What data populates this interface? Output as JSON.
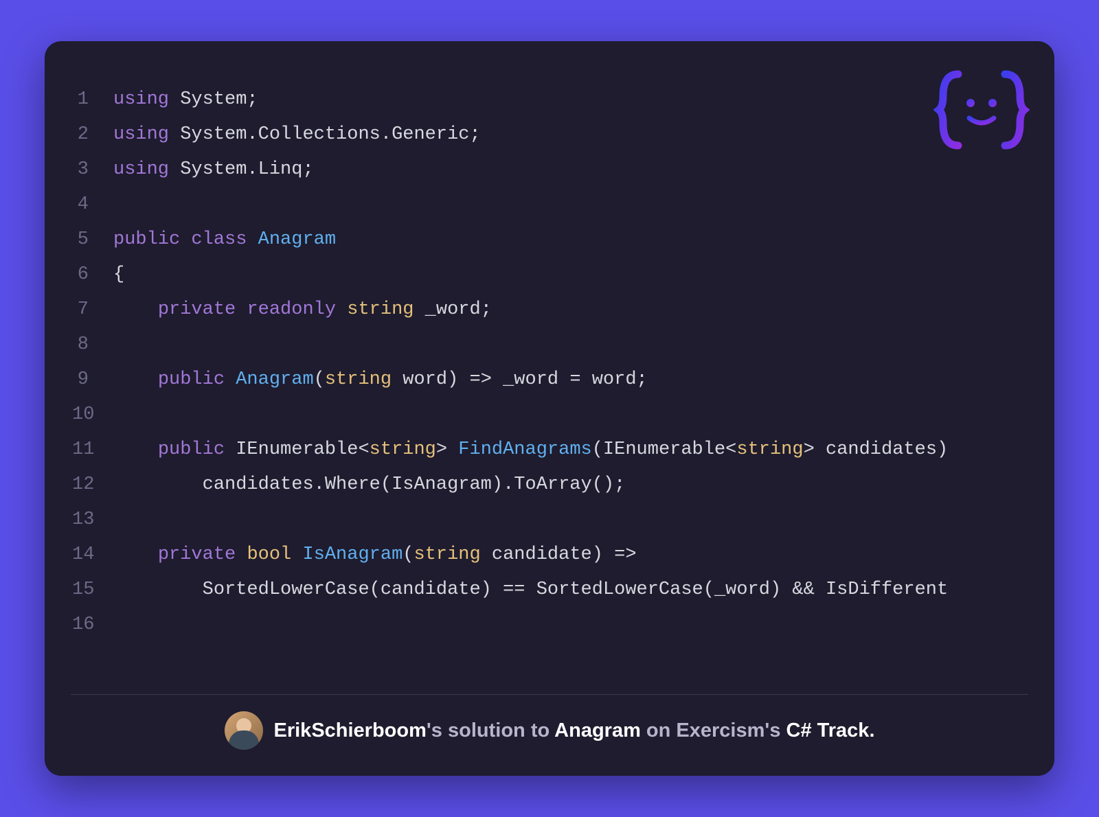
{
  "code": {
    "lines": [
      [
        {
          "t": "keyword",
          "v": "using"
        },
        {
          "t": "plain",
          "v": " System;"
        }
      ],
      [
        {
          "t": "keyword",
          "v": "using"
        },
        {
          "t": "plain",
          "v": " System.Collections.Generic;"
        }
      ],
      [
        {
          "t": "keyword",
          "v": "using"
        },
        {
          "t": "plain",
          "v": " System.Linq;"
        }
      ],
      [],
      [
        {
          "t": "keyword",
          "v": "public"
        },
        {
          "t": "plain",
          "v": " "
        },
        {
          "t": "keyword",
          "v": "class"
        },
        {
          "t": "plain",
          "v": " "
        },
        {
          "t": "type-blue",
          "v": "Anagram"
        }
      ],
      [
        {
          "t": "plain",
          "v": "{"
        }
      ],
      [
        {
          "t": "plain",
          "v": "    "
        },
        {
          "t": "keyword",
          "v": "private"
        },
        {
          "t": "plain",
          "v": " "
        },
        {
          "t": "keyword",
          "v": "readonly"
        },
        {
          "t": "plain",
          "v": " "
        },
        {
          "t": "type-yellow",
          "v": "string"
        },
        {
          "t": "plain",
          "v": " _word;"
        }
      ],
      [],
      [
        {
          "t": "plain",
          "v": "    "
        },
        {
          "t": "keyword",
          "v": "public"
        },
        {
          "t": "plain",
          "v": " "
        },
        {
          "t": "type-blue",
          "v": "Anagram"
        },
        {
          "t": "plain",
          "v": "("
        },
        {
          "t": "type-yellow",
          "v": "string"
        },
        {
          "t": "plain",
          "v": " word) => _word = word;"
        }
      ],
      [],
      [
        {
          "t": "plain",
          "v": "    "
        },
        {
          "t": "keyword",
          "v": "public"
        },
        {
          "t": "plain",
          "v": " IEnumerable<"
        },
        {
          "t": "type-yellow",
          "v": "string"
        },
        {
          "t": "plain",
          "v": "> "
        },
        {
          "t": "ident",
          "v": "FindAnagrams"
        },
        {
          "t": "plain",
          "v": "(IEnumerable<"
        },
        {
          "t": "type-yellow",
          "v": "string"
        },
        {
          "t": "plain",
          "v": "> candidates)"
        }
      ],
      [
        {
          "t": "plain",
          "v": "        candidates.Where(IsAnagram).ToArray();"
        }
      ],
      [],
      [
        {
          "t": "plain",
          "v": "    "
        },
        {
          "t": "keyword",
          "v": "private"
        },
        {
          "t": "plain",
          "v": " "
        },
        {
          "t": "type-yellow",
          "v": "bool"
        },
        {
          "t": "plain",
          "v": " "
        },
        {
          "t": "ident",
          "v": "IsAnagram"
        },
        {
          "t": "plain",
          "v": "("
        },
        {
          "t": "type-yellow",
          "v": "string"
        },
        {
          "t": "plain",
          "v": " candidate) =>"
        }
      ],
      [
        {
          "t": "plain",
          "v": "        SortedLowerCase(candidate) == SortedLowerCase(_word) && IsDifferent"
        }
      ],
      []
    ]
  },
  "attribution": {
    "user": "ErikSchierboom",
    "exercise": "Anagram",
    "platform": "Exercism",
    "track": "C# Track",
    "possessive1": "'s ",
    "mid1": "solution to ",
    "mid2": " on ",
    "possessive2": "'s ",
    "period": "."
  }
}
